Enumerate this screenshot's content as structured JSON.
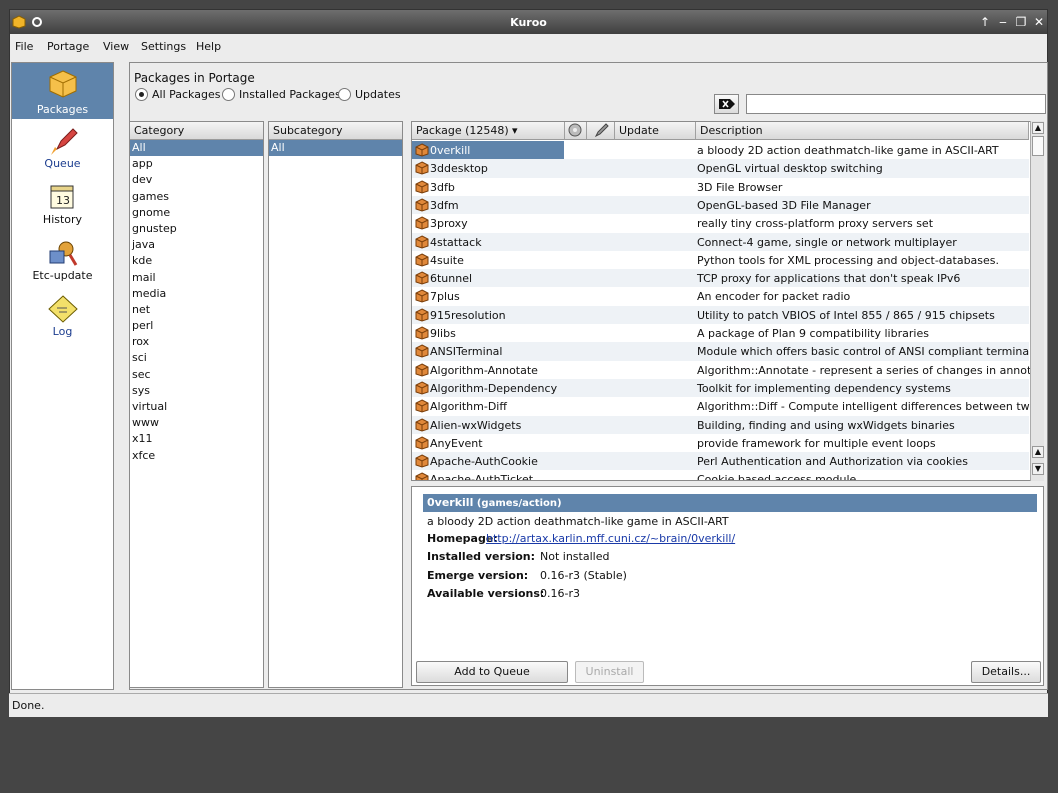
{
  "window": {
    "title": "Kuroo"
  },
  "menu": [
    "File",
    "Portage",
    "View",
    "Settings",
    "Help"
  ],
  "sidebar": {
    "items": [
      {
        "label": "Packages",
        "icon": "package-icon"
      },
      {
        "label": "Queue",
        "icon": "rocket-icon"
      },
      {
        "label": "History",
        "icon": "calendar-icon"
      },
      {
        "label": "Etc-update",
        "icon": "tools-icon"
      },
      {
        "label": "Log",
        "icon": "log-icon"
      }
    ]
  },
  "main": {
    "title": "Packages in Portage",
    "filters": [
      "All Packages",
      "Installed Packages",
      "Updates"
    ],
    "search": {
      "value": ""
    }
  },
  "categories": {
    "header": "Category",
    "items": [
      "All",
      "app",
      "dev",
      "games",
      "gnome",
      "gnustep",
      "java",
      "kde",
      "mail",
      "media",
      "net",
      "perl",
      "rox",
      "sci",
      "sec",
      "sys",
      "virtual",
      "www",
      "x11",
      "xfce"
    ]
  },
  "subcategories": {
    "header": "Subcategory",
    "items": [
      "All"
    ]
  },
  "packages": {
    "columns": {
      "package": "Package (12548)",
      "update": "Update",
      "description": "Description"
    },
    "rows": [
      {
        "name": "0verkill",
        "desc": "a bloody 2D action deathmatch-like game in ASCII-ART"
      },
      {
        "name": "3ddesktop",
        "desc": "OpenGL virtual desktop switching"
      },
      {
        "name": "3dfb",
        "desc": "3D File Browser"
      },
      {
        "name": "3dfm",
        "desc": "OpenGL-based 3D File Manager"
      },
      {
        "name": "3proxy",
        "desc": "really tiny cross-platform proxy servers set"
      },
      {
        "name": "4stattack",
        "desc": "Connect-4 game, single or network multiplayer"
      },
      {
        "name": "4suite",
        "desc": "Python tools for XML processing and object-databases."
      },
      {
        "name": "6tunnel",
        "desc": "TCP proxy for applications that don't speak IPv6"
      },
      {
        "name": "7plus",
        "desc": "An encoder for packet radio"
      },
      {
        "name": "915resolution",
        "desc": "Utility to patch VBIOS of Intel 855 / 865 / 915 chipsets"
      },
      {
        "name": "9libs",
        "desc": "A package of Plan 9 compatibility libraries"
      },
      {
        "name": "ANSITerminal",
        "desc": "Module which offers basic control of ANSI compliant terminals"
      },
      {
        "name": "Algorithm-Annotate",
        "desc": "Algorithm::Annotate - represent a series of changes in annotate form"
      },
      {
        "name": "Algorithm-Dependency",
        "desc": "Toolkit for implementing dependency systems"
      },
      {
        "name": "Algorithm-Diff",
        "desc": "Algorithm::Diff - Compute intelligent differences between two files / lists"
      },
      {
        "name": "Alien-wxWidgets",
        "desc": "Building, finding and using wxWidgets binaries"
      },
      {
        "name": "AnyEvent",
        "desc": "provide framework for multiple event loops"
      },
      {
        "name": "Apache-AuthCookie",
        "desc": "Perl Authentication and Authorization via cookies"
      },
      {
        "name": "Apache-AuthTicket",
        "desc": "Cookie based access module"
      }
    ]
  },
  "details": {
    "name": "0verkill",
    "path": "(games/action)",
    "description": "a bloody 2D action deathmatch-like game in ASCII-ART",
    "homepage_label": "Homepage:",
    "homepage": "http://artax.karlin.mff.cuni.cz/~brain/0verkill/",
    "installed_label": "Installed version:",
    "installed": "Not installed",
    "emerge_label": "Emerge version:",
    "emerge": "0.16-r3 (Stable)",
    "available_label": "Available versions:",
    "available": "0.16-r3"
  },
  "buttons": {
    "add": "Add to Queue",
    "uninstall": "Uninstall",
    "details": "Details..."
  },
  "status": "Done.",
  "colors": {
    "selection": "#5f84ab",
    "titlebar": "#4a4a4a",
    "background": "#454545"
  }
}
